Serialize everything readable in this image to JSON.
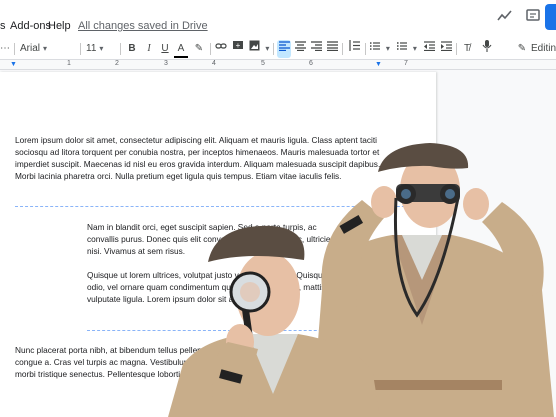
{
  "menubar": {
    "addons_label": "Add-ons",
    "help_label": "Help",
    "saved_status": "All changes saved in Drive",
    "icons": [
      "activity-icon",
      "comment-icon"
    ]
  },
  "toolbar": {
    "font": "Arial",
    "size": "11",
    "bold": "B",
    "italic": "I",
    "underline": "U",
    "text_color": "A",
    "mode": "Editing"
  },
  "ruler": {
    "numbers": [
      "1",
      "2",
      "3",
      "4",
      "5",
      "6",
      "7"
    ]
  },
  "document": {
    "p1": "Lorem ipsum dolor sit amet, consectetur adipiscing elit. Aliquam et mauris ligula. Class aptent taciti sociosqu ad litora torquent per conubia nostra, per inceptos himenaeos. Mauris malesuada tortor et imperdiet suscipit. Maecenas id nisl eu eros gravida interdum. Aliquam malesuada suscipit dapibus. Morbi lacinia pharetra orci. Nulla pretium eget ligula quis tempus. Etiam vitae iaculis felis.",
    "p2": "Nam in blandit orci, eget suscipit sapien. Sed a porta turpis, ac convallis purus. Donec quis elit convallis, bibendum nisl ac, ultricies nisi. Vivamus at sem risus.",
    "p3": "Quisque ut lorem ultrices, volutpat justo vel, ornare odio. Quisque odio odio, vel ornare quam condimentum quis. Quisque nisl eu, mattis vulputate ligula. Lorem ipsum dolor sit adipiscing elit.",
    "p4": "Nunc placerat porta nibh, at bibendum tellus pellentesque. Vestibulum ligula magna, fringilla odio congue a. Cras vel turpis ac magna. Vestibulum sodales lacus in faucibus. Pellentesque habitant morbi tristique senectus. Pellentesque lobortis tellus dolor."
  },
  "colors": {
    "accent": "#1a73e8",
    "coat": "#c8ad8a",
    "cap": "#5a4d42",
    "skin": "#e7c0a5"
  }
}
